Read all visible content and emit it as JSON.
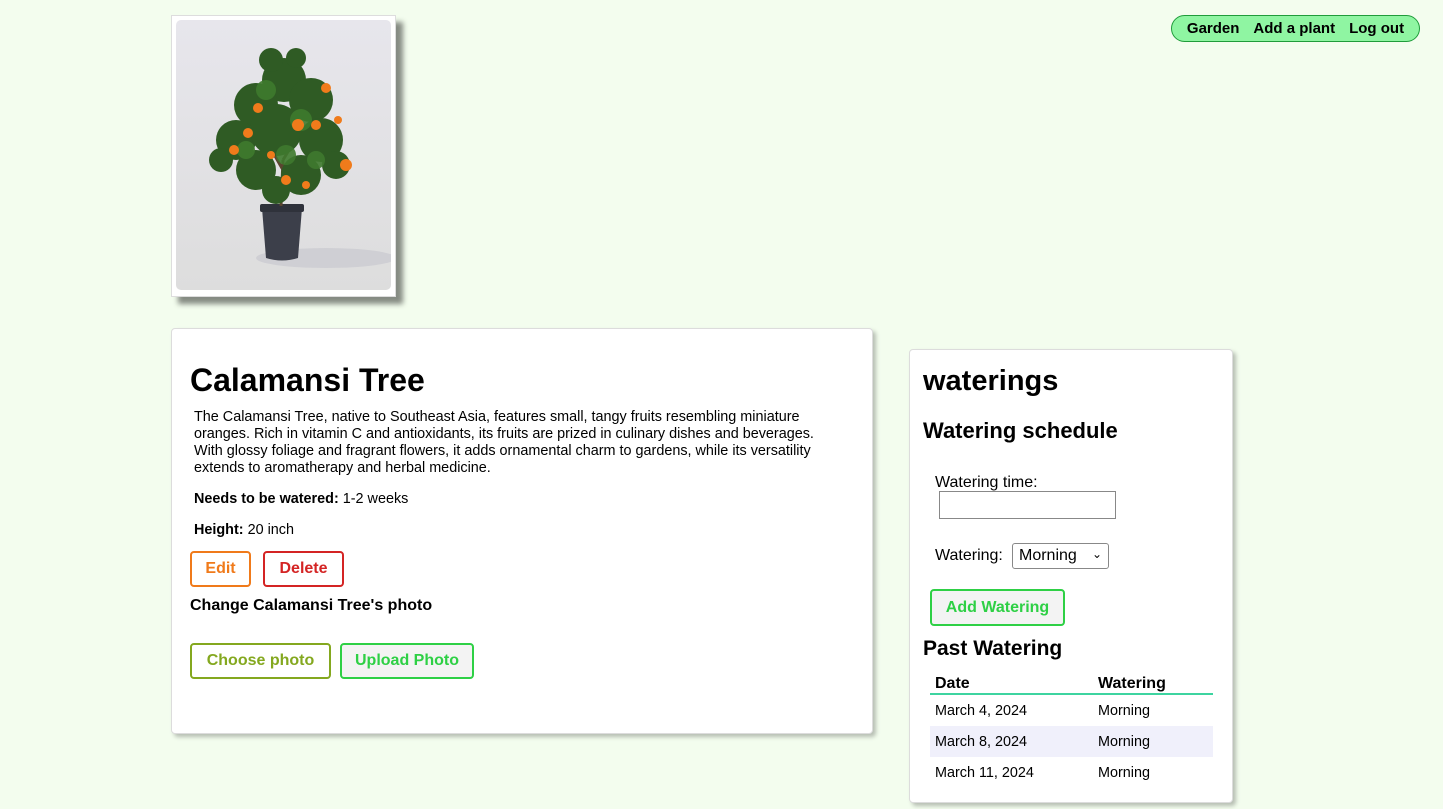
{
  "nav": {
    "items": [
      "Garden",
      "Add a plant",
      "Log out"
    ]
  },
  "plant": {
    "name": "Calamansi Tree",
    "description": "The Calamansi Tree, native to Southeast Asia, features small, tangy fruits resembling miniature oranges. Rich in vitamin C and antioxidants, its fruits are prized in culinary dishes and beverages. With glossy foliage and fragrant flowers, it adds ornamental charm to gardens, while its versatility extends to aromatherapy and herbal medicine.",
    "watering_label": "Needs to be watered:",
    "watering_value": "1-2 weeks",
    "height_label": "Height:",
    "height_value": "20 inch",
    "edit_label": "Edit",
    "delete_label": "Delete",
    "change_photo_heading": "Change Calamansi Tree's photo",
    "choose_photo_label": "Choose photo",
    "upload_photo_label": "Upload Photo"
  },
  "waterings": {
    "title": "waterings",
    "schedule_heading": "Watering schedule",
    "time_label": "Watering time:",
    "time_value": "",
    "watering_label": "Watering:",
    "watering_selected": "Morning",
    "add_button": "Add Watering",
    "past_heading": "Past Watering",
    "columns": [
      "Date",
      "Watering"
    ],
    "rows": [
      [
        "March 4, 2024",
        "Morning"
      ],
      [
        "March 8, 2024",
        "Morning"
      ],
      [
        "March 11, 2024",
        "Morning"
      ]
    ]
  },
  "colors": {
    "background": "#f3fdee",
    "nav_bg": "#8ff5a2",
    "edit": "#f07a1a",
    "delete": "#d42424",
    "choose": "#84a81f",
    "upload": "#2ed045",
    "table_rule": "#3dd4a0"
  }
}
